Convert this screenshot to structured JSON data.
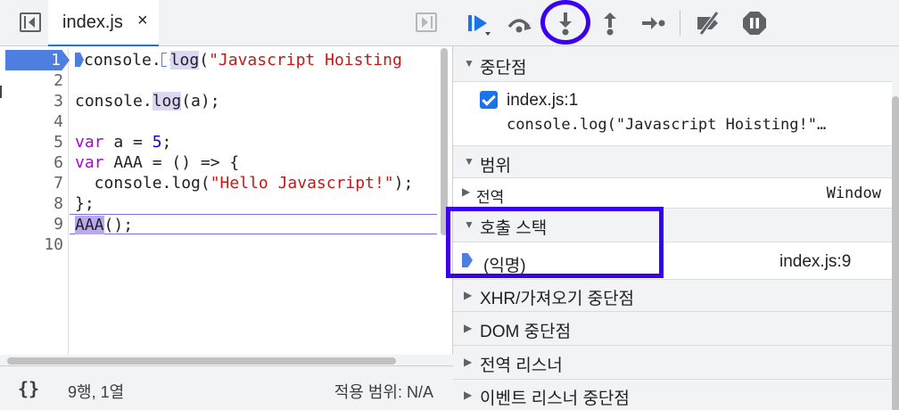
{
  "editor": {
    "tab_label": "index.js",
    "tab_close": "×",
    "lines": [
      "1",
      "2",
      "3",
      "4",
      "5",
      "6",
      "7",
      "8",
      "9",
      "10"
    ],
    "status": {
      "format": "{}",
      "cursor": "9행, 1열",
      "coverage": "적용 범위: N/A"
    }
  },
  "code": {
    "l1_a": "console.",
    "l1_b": "log",
    "l1_c": "(",
    "l1_d": "\"Javascript Hoisting",
    "l3_a": "console.",
    "l3_b": "log",
    "l3_c": "(a);",
    "l5_kw": "var",
    "l5_a": " a = ",
    "l5_num": "5",
    "l5_b": ";",
    "l6_kw": "var",
    "l6_a": " AAA = () => {",
    "l7_a": "  console.log(",
    "l7_str": "\"Hello Javascript!\"",
    "l7_b": ");",
    "l8": "};",
    "l9_a": "AAA",
    "l9_b": "();"
  },
  "sidebar": {
    "breakpoints": {
      "title": "중단점",
      "file": "index.js:1",
      "code": "console.log(\"Javascript Hoisting!\"…"
    },
    "scope": {
      "title": "범위",
      "global_label": "전역",
      "global_value": "Window"
    },
    "callstack": {
      "title": "호출 스택",
      "frame_name": "(익명)",
      "frame_location": "index.js:9"
    },
    "xhr": {
      "title": "XHR/가져오기 중단점"
    },
    "dom": {
      "title": "DOM 중단점"
    },
    "global_listeners": {
      "title": "전역 리스너"
    },
    "event_listeners": {
      "title": "이벤트 리스너 중단점"
    }
  },
  "colors": {
    "accent": "#1a73e8",
    "breakpoint": "#4e7fe0",
    "annotation": "#3a00f0"
  },
  "icons": {
    "resume": "resume-icon",
    "step_over": "step-over-icon",
    "step_into": "step-into-icon",
    "step_out": "step-out-icon",
    "step": "step-icon",
    "deactivate": "deactivate-breakpoints-icon",
    "pause_exceptions": "pause-on-exceptions-icon"
  }
}
